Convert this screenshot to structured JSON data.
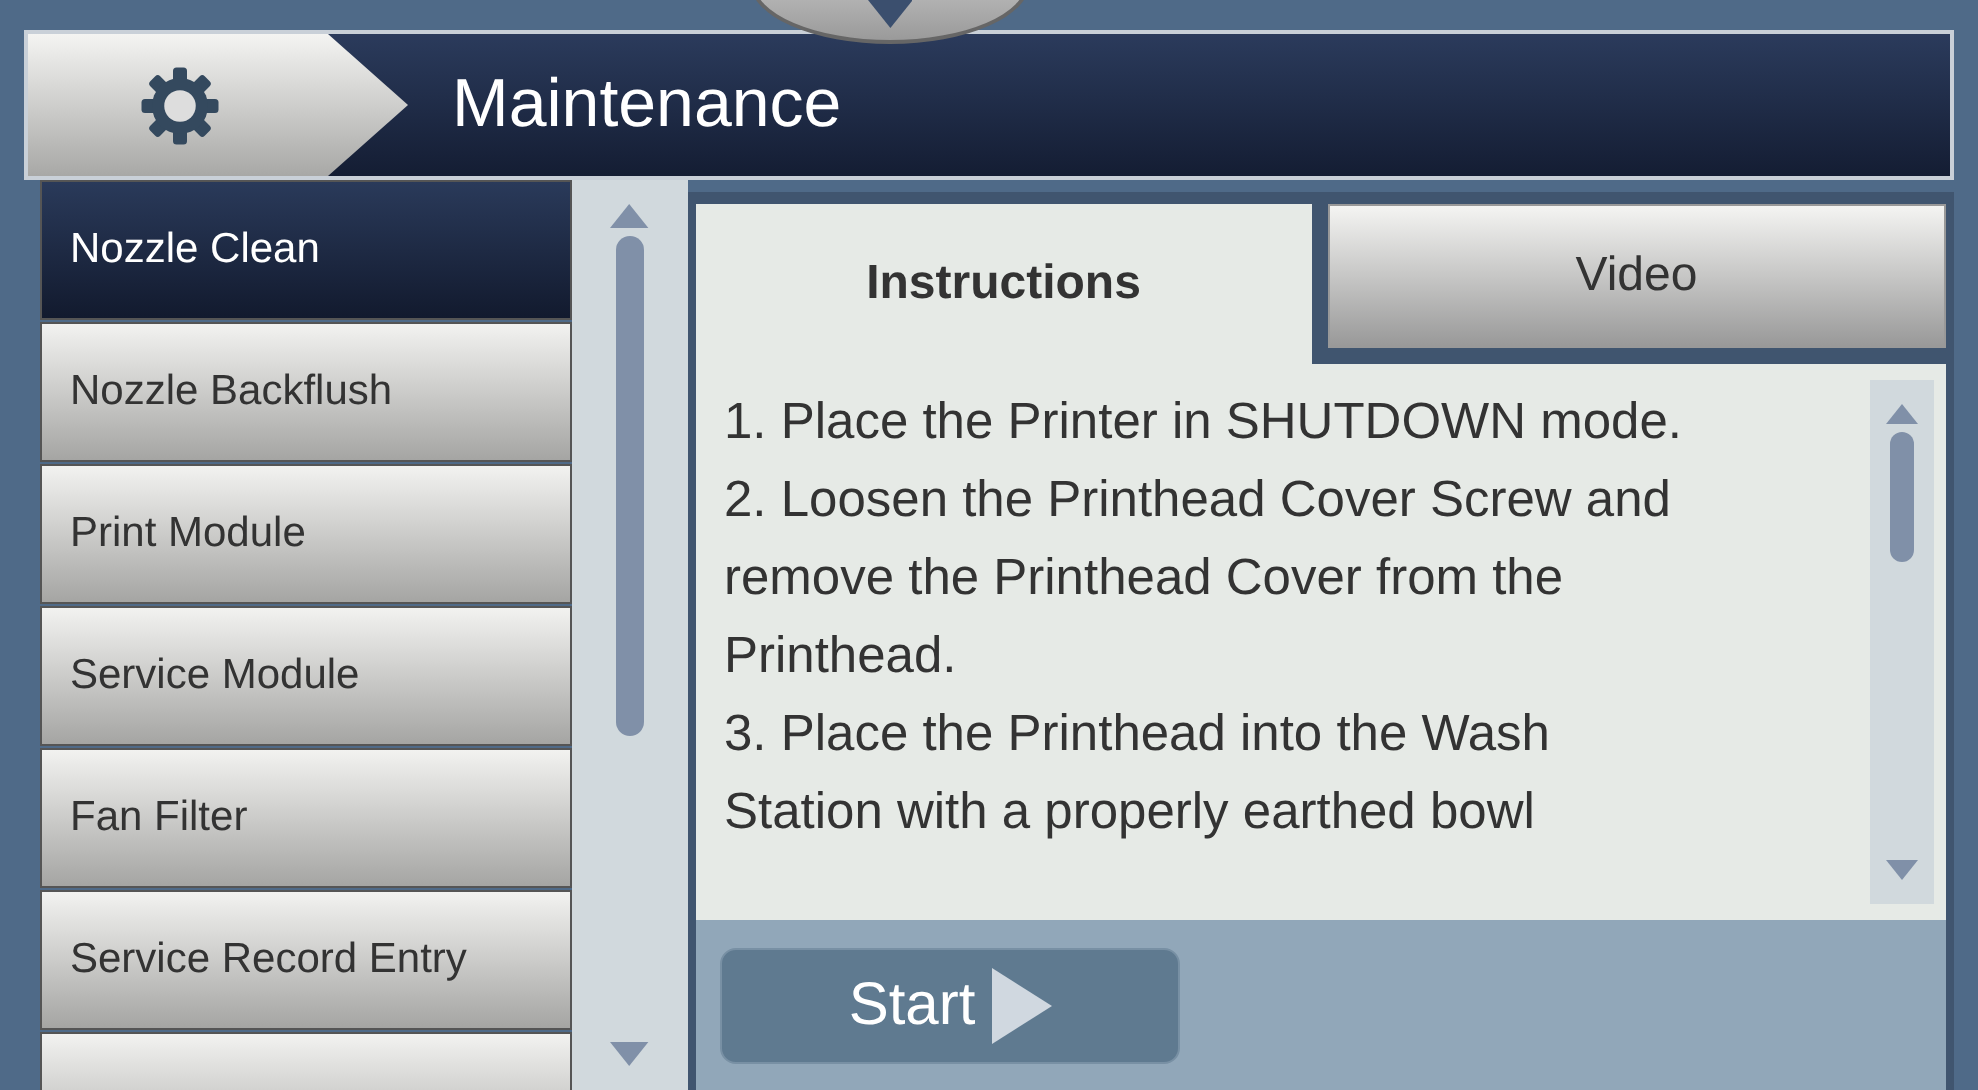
{
  "header": {
    "title": "Maintenance"
  },
  "sidebar": {
    "items": [
      {
        "label": "Nozzle Clean",
        "selected": true
      },
      {
        "label": "Nozzle Backflush",
        "selected": false
      },
      {
        "label": "Print Module",
        "selected": false
      },
      {
        "label": "Service Module",
        "selected": false
      },
      {
        "label": "Fan Filter",
        "selected": false
      },
      {
        "label": "Service Record Entry",
        "selected": false
      },
      {
        "selected": false
      }
    ]
  },
  "tabs": [
    {
      "label": "Instructions",
      "selected": true
    },
    {
      "label": "Video",
      "selected": false
    }
  ],
  "instructions": [
    "1. Place the Printer in SHUTDOWN mode.",
    "2. Loosen the  Printhead Cover Screw and remove the Printhead Cover from the Printhead.",
    "3. Place the Printhead into the Wash Station with a properly earthed bowl"
  ],
  "start_button": {
    "label": "Start"
  }
}
